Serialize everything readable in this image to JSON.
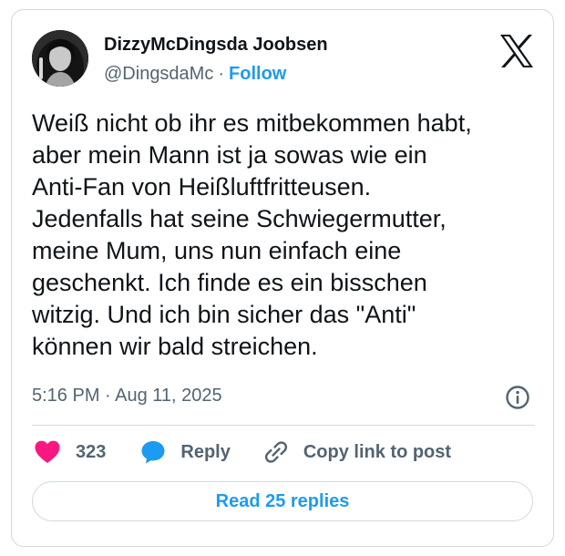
{
  "author": {
    "display_name": "DizzyMcDingsda Joobsen",
    "handle": "@DingsdaMc",
    "separator": "·",
    "follow_label": "Follow"
  },
  "tweet": {
    "text": "Weiß nicht ob ihr es mitbekommen habt,\naber mein Mann ist ja sowas wie ein\nAnti-Fan von Heißluftfritteusen.\nJedenfalls hat seine Schwiegermutter,\nmeine Mum, uns nun einfach eine\ngeschenkt. Ich finde es ein bisschen\nwitzig. Und ich bin sicher das \"Anti\"\nkönnen wir bald streichen.",
    "timestamp": "5:16 PM · Aug 11, 2025"
  },
  "actions": {
    "like_count": "323",
    "reply_label": "Reply",
    "copy_link_label": "Copy link to post"
  },
  "footer": {
    "read_replies_label": "Read 25 replies"
  },
  "colors": {
    "accent": "#1d9bf0",
    "like": "#f91880",
    "muted_text": "#536471",
    "border": "#cfd9de"
  },
  "icons": {
    "platform": "x-logo-icon",
    "info": "info-icon",
    "like": "heart-icon",
    "reply": "speech-bubble-icon",
    "copy": "link-icon"
  }
}
